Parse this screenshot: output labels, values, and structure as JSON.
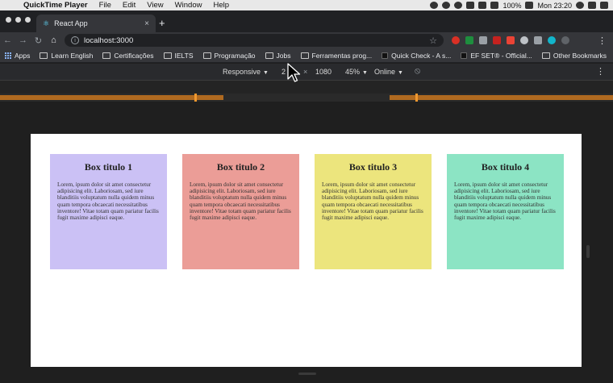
{
  "menubar": {
    "app_name": "QuickTime Player",
    "items": [
      "File",
      "Edit",
      "View",
      "Window",
      "Help"
    ],
    "battery": "100%",
    "clock": "Mon 23:20"
  },
  "browser": {
    "tab_title": "React App",
    "tab_close": "×",
    "new_tab": "+",
    "url": "localhost:3000"
  },
  "bookmarks": [
    "Apps",
    "Learn English",
    "Certificações",
    "IELTS",
    "Programação",
    "Jobs",
    "Ferramentas prog...",
    "Quick Check - A s...",
    "EF SET® - Official...",
    "Other Bookmarks"
  ],
  "devtools": {
    "device": "Responsive",
    "width": "2",
    "times": "×",
    "height": "1080",
    "zoom": "45%",
    "throttle": "Online"
  },
  "page": {
    "boxes": [
      {
        "title": "Box titulo 1",
        "color": "#cbc1f5",
        "text": "Lorem, ipsum dolor sit amet consectetur adipisicing elit. Laboriosam, sed iure blanditiis voluptatum nulla quidem minus quam tempora obcaecati necessitatibus inventore! Vitae totam quam pariatur facilis fugit maxime adipisci eaque."
      },
      {
        "title": "Box titulo 2",
        "color": "#eb9d97",
        "text": "Lorem, ipsum dolor sit amet consectetur adipisicing elit. Laboriosam, sed iure blanditiis voluptatum nulla quidem minus quam tempora obcaecati necessitatibus inventore! Vitae totam quam pariatur facilis fugit maxime adipisci eaque."
      },
      {
        "title": "Box titulo 3",
        "color": "#ece57d",
        "text": "Lorem, ipsum dolor sit amet consectetur adipisicing elit. Laboriosam, sed iure blanditiis voluptatum nulla quidem minus quam tempora obcaecati necessitatibus inventore! Vitae totam quam pariatur facilis fugit maxime adipisci eaque."
      },
      {
        "title": "Box titulo 4",
        "color": "#8ce4c4",
        "text": "Lorem, ipsum dolor sit amet consectetur adipisicing elit. Laboriosam, sed iure blanditiis voluptatum nulla quidem minus quam tempora obcaecati necessitatibus inventore! Vitae totam quam pariatur facilis fugit maxime adipisci eaque."
      }
    ]
  }
}
